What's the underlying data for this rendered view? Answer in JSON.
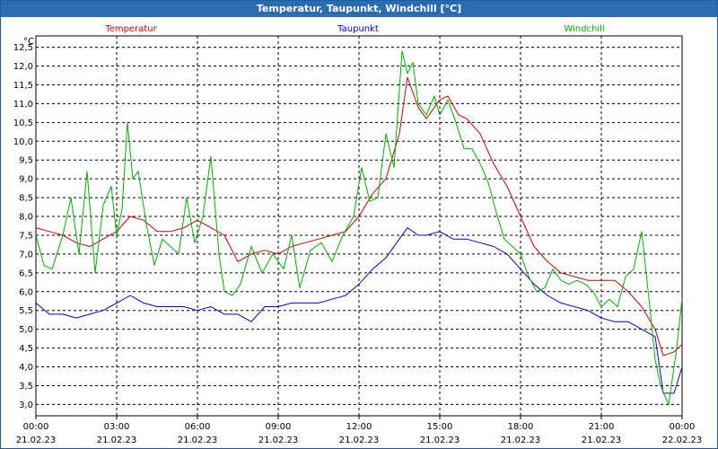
{
  "window": {
    "title": "Temperatur, Taupunkt, Windchill [°C]"
  },
  "colors": {
    "temperature": "#cc0000",
    "dewpoint": "#0000cc",
    "windchill": "#00b000",
    "titlebar": "#2b6cb0"
  },
  "chart_data": {
    "type": "line",
    "title": "Temperatur, Taupunkt, Windchill [°C]",
    "ylabel": "°C",
    "ylim": [
      2.7,
      12.8
    ],
    "xlim": [
      0,
      24
    ],
    "grid": true,
    "legend_position": "top",
    "y_ticks": [
      "3,0",
      "3,5",
      "4,0",
      "4,5",
      "5,0",
      "5,5",
      "6,0",
      "6,5",
      "7,0",
      "7,5",
      "8,0",
      "8,5",
      "9,0",
      "9,5",
      "10,0",
      "10,5",
      "11,0",
      "11,5",
      "12,0",
      "12,5"
    ],
    "x_ticks": [
      {
        "time": "00:00",
        "date": "21.02.23"
      },
      {
        "time": "03:00",
        "date": "21.02.23"
      },
      {
        "time": "06:00",
        "date": "21.02.23"
      },
      {
        "time": "09:00",
        "date": "21.02.23"
      },
      {
        "time": "12:00",
        "date": "21.02.23"
      },
      {
        "time": "15:00",
        "date": "21.02.23"
      },
      {
        "time": "18:00",
        "date": "21.02.23"
      },
      {
        "time": "21:00",
        "date": "21.02.23"
      },
      {
        "time": "00:00",
        "date": "22.02.23"
      }
    ],
    "series": [
      {
        "name": "Temperatur",
        "color": "#cc0000",
        "x": [
          0,
          0.5,
          1,
          1.5,
          2,
          2.5,
          3,
          3.5,
          4,
          4.5,
          5,
          5.5,
          6,
          6.5,
          7,
          7.5,
          8,
          8.5,
          9,
          9.5,
          10,
          10.5,
          11,
          11.5,
          12,
          12.5,
          13,
          13.5,
          13.8,
          14.2,
          14.5,
          15,
          15.3,
          15.7,
          16,
          16.5,
          17,
          17.5,
          18,
          18.5,
          19,
          19.5,
          20,
          20.5,
          21,
          21.5,
          22,
          22.5,
          23,
          23.3,
          23.7,
          24
        ],
        "y": [
          7.7,
          7.6,
          7.5,
          7.3,
          7.2,
          7.4,
          7.6,
          8.0,
          7.9,
          7.6,
          7.6,
          7.7,
          7.9,
          7.7,
          7.5,
          6.8,
          7.0,
          7.1,
          7.0,
          7.2,
          7.3,
          7.4,
          7.5,
          7.6,
          8.0,
          8.6,
          9.0,
          10.2,
          11.7,
          10.9,
          10.6,
          11.1,
          11.2,
          10.7,
          10.6,
          10.2,
          9.4,
          8.8,
          8.0,
          7.2,
          6.8,
          6.5,
          6.4,
          6.3,
          6.3,
          6.3,
          6.0,
          5.6,
          5.0,
          4.3,
          4.4,
          4.6
        ]
      },
      {
        "name": "Taupunkt",
        "color": "#0000cc",
        "x": [
          0,
          0.5,
          1,
          1.5,
          2,
          2.5,
          3,
          3.5,
          4,
          4.5,
          5,
          5.5,
          6,
          6.5,
          7,
          7.5,
          8,
          8.5,
          9,
          9.5,
          10,
          10.5,
          11,
          11.5,
          12,
          12.5,
          13,
          13.5,
          13.8,
          14.2,
          14.5,
          15,
          15.5,
          16,
          16.5,
          17,
          17.5,
          18,
          18.5,
          19,
          19.5,
          20,
          20.5,
          21,
          21.5,
          22,
          22.5,
          23,
          23.3,
          23.7,
          24
        ],
        "y": [
          5.7,
          5.4,
          5.4,
          5.3,
          5.4,
          5.5,
          5.7,
          5.9,
          5.7,
          5.6,
          5.6,
          5.6,
          5.5,
          5.6,
          5.4,
          5.4,
          5.2,
          5.6,
          5.6,
          5.7,
          5.7,
          5.7,
          5.8,
          5.9,
          6.2,
          6.6,
          6.9,
          7.4,
          7.7,
          7.5,
          7.5,
          7.6,
          7.4,
          7.4,
          7.3,
          7.2,
          7.0,
          6.6,
          6.2,
          5.9,
          5.7,
          5.6,
          5.5,
          5.3,
          5.2,
          5.2,
          5.0,
          4.8,
          3.3,
          3.3,
          4.0
        ]
      },
      {
        "name": "Windchill",
        "color": "#00b000",
        "x": [
          0,
          0.3,
          0.6,
          1,
          1.3,
          1.6,
          1.9,
          2.2,
          2.5,
          2.8,
          3,
          3.2,
          3.4,
          3.6,
          3.8,
          4.1,
          4.4,
          4.7,
          5,
          5.3,
          5.6,
          5.9,
          6.2,
          6.5,
          6.8,
          7,
          7.3,
          7.6,
          8,
          8.4,
          8.8,
          9.2,
          9.5,
          9.8,
          10.2,
          10.6,
          11,
          11.4,
          11.8,
          12.1,
          12.4,
          12.7,
          13,
          13.3,
          13.6,
          13.8,
          14,
          14.2,
          14.5,
          14.8,
          15,
          15.3,
          15.6,
          15.9,
          16.2,
          16.5,
          16.8,
          17.1,
          17.4,
          17.7,
          18,
          18.3,
          18.6,
          18.9,
          19.2,
          19.5,
          19.8,
          20.1,
          20.4,
          20.7,
          21,
          21.3,
          21.6,
          21.9,
          22.2,
          22.5,
          22.8,
          23,
          23.2,
          23.5,
          23.8,
          24
        ],
        "y": [
          7.5,
          6.7,
          6.6,
          7.5,
          8.5,
          7.0,
          9.2,
          6.5,
          8.3,
          8.8,
          7.5,
          8.2,
          10.5,
          9.0,
          9.2,
          7.8,
          6.7,
          7.4,
          7.2,
          7.0,
          8.5,
          7.3,
          8.0,
          9.6,
          7.0,
          6.0,
          5.9,
          6.2,
          7.2,
          6.5,
          7.0,
          6.6,
          7.5,
          6.1,
          7.1,
          7.3,
          6.8,
          7.5,
          8.0,
          9.3,
          8.4,
          8.5,
          10.2,
          9.3,
          12.4,
          11.8,
          12.1,
          11.0,
          10.7,
          11.2,
          10.7,
          11.1,
          10.5,
          9.8,
          9.8,
          9.4,
          8.9,
          8.1,
          7.4,
          7.2,
          7.0,
          6.4,
          6.0,
          6.1,
          6.6,
          6.3,
          6.2,
          6.3,
          6.2,
          6.0,
          5.6,
          5.8,
          5.6,
          6.4,
          6.6,
          7.6,
          5.6,
          4.2,
          3.5,
          3.0,
          4.5,
          5.8
        ]
      }
    ]
  }
}
